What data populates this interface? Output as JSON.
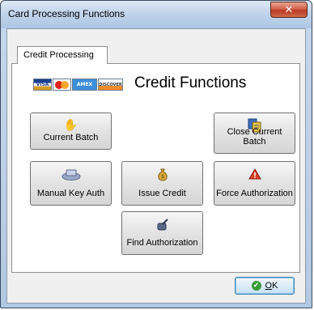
{
  "window": {
    "title": "Card Processing Functions",
    "close_icon": "close-icon"
  },
  "tabs": [
    {
      "label": "Credit Processing",
      "active": true
    }
  ],
  "cards": [
    {
      "name": "VISA",
      "icon": "visa-card-icon"
    },
    {
      "name": "",
      "icon": "mastercard-icon"
    },
    {
      "name": "AMEX",
      "icon": "amex-card-icon"
    },
    {
      "name": "DISCOVER",
      "icon": "discover-card-icon"
    }
  ],
  "heading": "Credit Functions",
  "buttons": {
    "current_batch": {
      "label": "Current Batch",
      "icon": "hand-batch-icon"
    },
    "close_current_batch": {
      "label": "Close Current Batch",
      "icon": "close-batch-icon"
    },
    "manual_key_auth": {
      "label": "Manual Key Auth",
      "icon": "card-swipe-icon"
    },
    "issue_credit": {
      "label": "Issue Credit",
      "icon": "money-bag-icon"
    },
    "force_authorization": {
      "label": "Force Authorization",
      "icon": "warning-icon"
    },
    "find_authorization": {
      "label": "Find Authorization",
      "icon": "find-icon"
    }
  },
  "ok_button": {
    "label_prefix": "",
    "label_underlined": "O",
    "label_rest": "K",
    "icon": "check-icon"
  },
  "colors": {
    "title_bar": "#c3d5ea",
    "close_button": "#c9472e",
    "ok_border": "#3c7fb1",
    "panel_bg": "#ffffff"
  }
}
